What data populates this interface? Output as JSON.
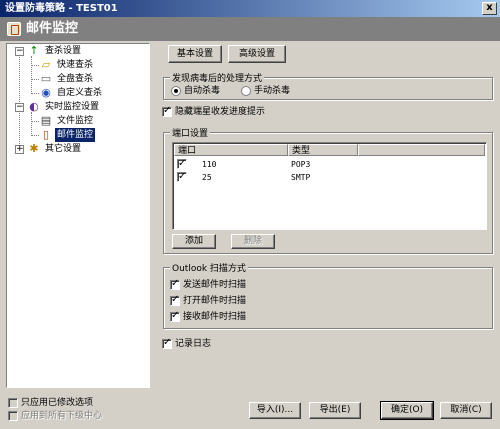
{
  "window": {
    "title": "设置防毒策略 - TEST01",
    "close_glyph": "x"
  },
  "header": {
    "title": "邮件监控",
    "icon": "mail-monitor-icon"
  },
  "tree": {
    "items": [
      {
        "label": "查杀设置",
        "icon": "scan-arrow-icon",
        "expand": "−"
      },
      {
        "label": "快速查杀",
        "icon": "folder-icon"
      },
      {
        "label": "全盘查杀",
        "icon": "disk-icon"
      },
      {
        "label": "自定义查杀",
        "icon": "custom-scan-icon"
      },
      {
        "label": "实时监控设置",
        "icon": "monitor-icon",
        "expand": "−"
      },
      {
        "label": "文件监控",
        "icon": "file-icon"
      },
      {
        "label": "邮件监控",
        "icon": "mail-icon",
        "selected": true
      },
      {
        "label": "其它设置",
        "icon": "settings-icon",
        "expand": "+"
      }
    ]
  },
  "tabs": {
    "basic": "基本设置",
    "advanced": "高级设置"
  },
  "virus_action": {
    "title": "发现病毒后的处理方式",
    "options": [
      "自动杀毒",
      "手动杀毒"
    ],
    "selected": "自动杀毒"
  },
  "hide_progress": {
    "label": "隐藏端星收发进度提示",
    "checked": true
  },
  "port_settings": {
    "title": "端口设置",
    "columns": [
      "端口",
      "类型"
    ],
    "rows": [
      {
        "port": "110",
        "type": "POP3",
        "checked": true
      },
      {
        "port": "25",
        "type": "SMTP",
        "checked": true
      }
    ],
    "add_label": "添加",
    "delete_label": "删除"
  },
  "outlook_scan": {
    "title": "Outlook 扫描方式",
    "options": [
      {
        "label": "发送邮件时扫描",
        "checked": true
      },
      {
        "label": "打开邮件时扫描",
        "checked": true
      },
      {
        "label": "接收邮件时扫描",
        "checked": true
      }
    ]
  },
  "log": {
    "label": "记录日志",
    "checked": true
  },
  "footer": {
    "apply_modified_label": "只应用已修改选项",
    "apply_all_label": "应用到所有下级中心",
    "import_label": "导入(I)...",
    "export_label": "导出(E)",
    "ok_label": "确定(O)",
    "cancel_label": "取消(C)"
  }
}
